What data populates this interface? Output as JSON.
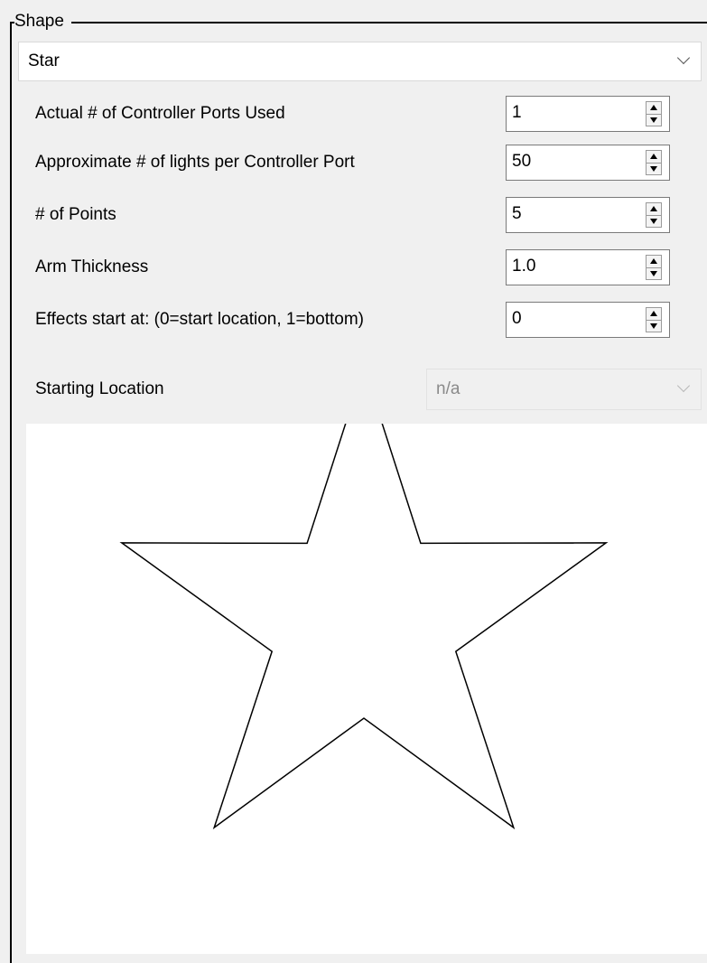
{
  "group": {
    "title": "Shape"
  },
  "shape_select": {
    "value": "Star"
  },
  "fields": [
    {
      "label": "Actual # of Controller Ports Used",
      "value": "1"
    },
    {
      "label": "Approximate # of lights per Controller Port",
      "value": "50"
    },
    {
      "label": "# of Points",
      "value": "5"
    },
    {
      "label": "Arm Thickness",
      "value": "1.0"
    },
    {
      "label": "Effects start at: (0=start location, 1=bottom)",
      "value": "0"
    }
  ],
  "starting_location": {
    "label": "Starting Location",
    "value": "n/a"
  },
  "icons": {
    "dropdown": "chevron-down-icon",
    "spin_up": "arrow-up-icon",
    "spin_down": "arrow-down-icon"
  },
  "preview": {
    "shape": "star",
    "points": 5,
    "stroke_color": "#000000"
  }
}
